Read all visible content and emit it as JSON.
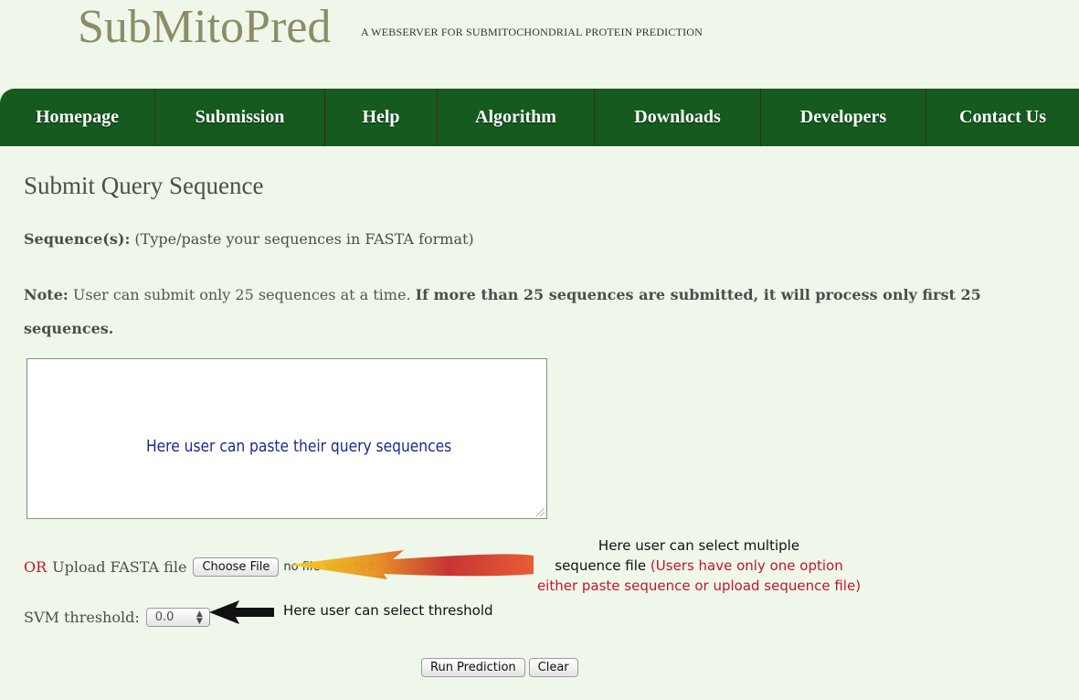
{
  "header": {
    "logo": "SubMitoPred",
    "tagline": "A WEBSERVER FOR SUBMITOCHONDRIAL PROTEIN PREDICTION"
  },
  "nav": {
    "items": [
      {
        "label": "Homepage"
      },
      {
        "label": "Submission"
      },
      {
        "label": "Help"
      },
      {
        "label": "Algorithm"
      },
      {
        "label": "Downloads"
      },
      {
        "label": "Developers"
      },
      {
        "label": "Contact Us"
      }
    ]
  },
  "main": {
    "title": "Submit Query Sequence",
    "sequence_label": "Sequence(s):",
    "sequence_hint": " (Type/paste your sequences in FASTA format)",
    "note_label": "Note:",
    "note_text": " User can submit only 25 sequences at a time. ",
    "note_bold": "If more than 25 sequences are submitted, it will process only first 25 sequences.",
    "textarea_hint": "Here user can paste their query sequences",
    "upload_or": "OR",
    "upload_label": "Upload FASTA file",
    "choose_file_label": "Choose File",
    "no_file_text": "no file selected",
    "svm_label": "SVM threshold:",
    "svm_value": "0.0",
    "run_button": "Run Prediction",
    "clear_button": "Clear"
  },
  "annotations": {
    "upload_line1": "Here user can select multiple",
    "upload_line2": "sequence file ",
    "upload_red": "(Users have only one option either paste sequence or upload sequence file)",
    "threshold": "Here user can select threshold"
  },
  "colors": {
    "nav_bg": "#155a1f",
    "page_bg": "#eef7ea",
    "accent_red": "#c0172b",
    "hint_blue": "#1c2b8c"
  }
}
